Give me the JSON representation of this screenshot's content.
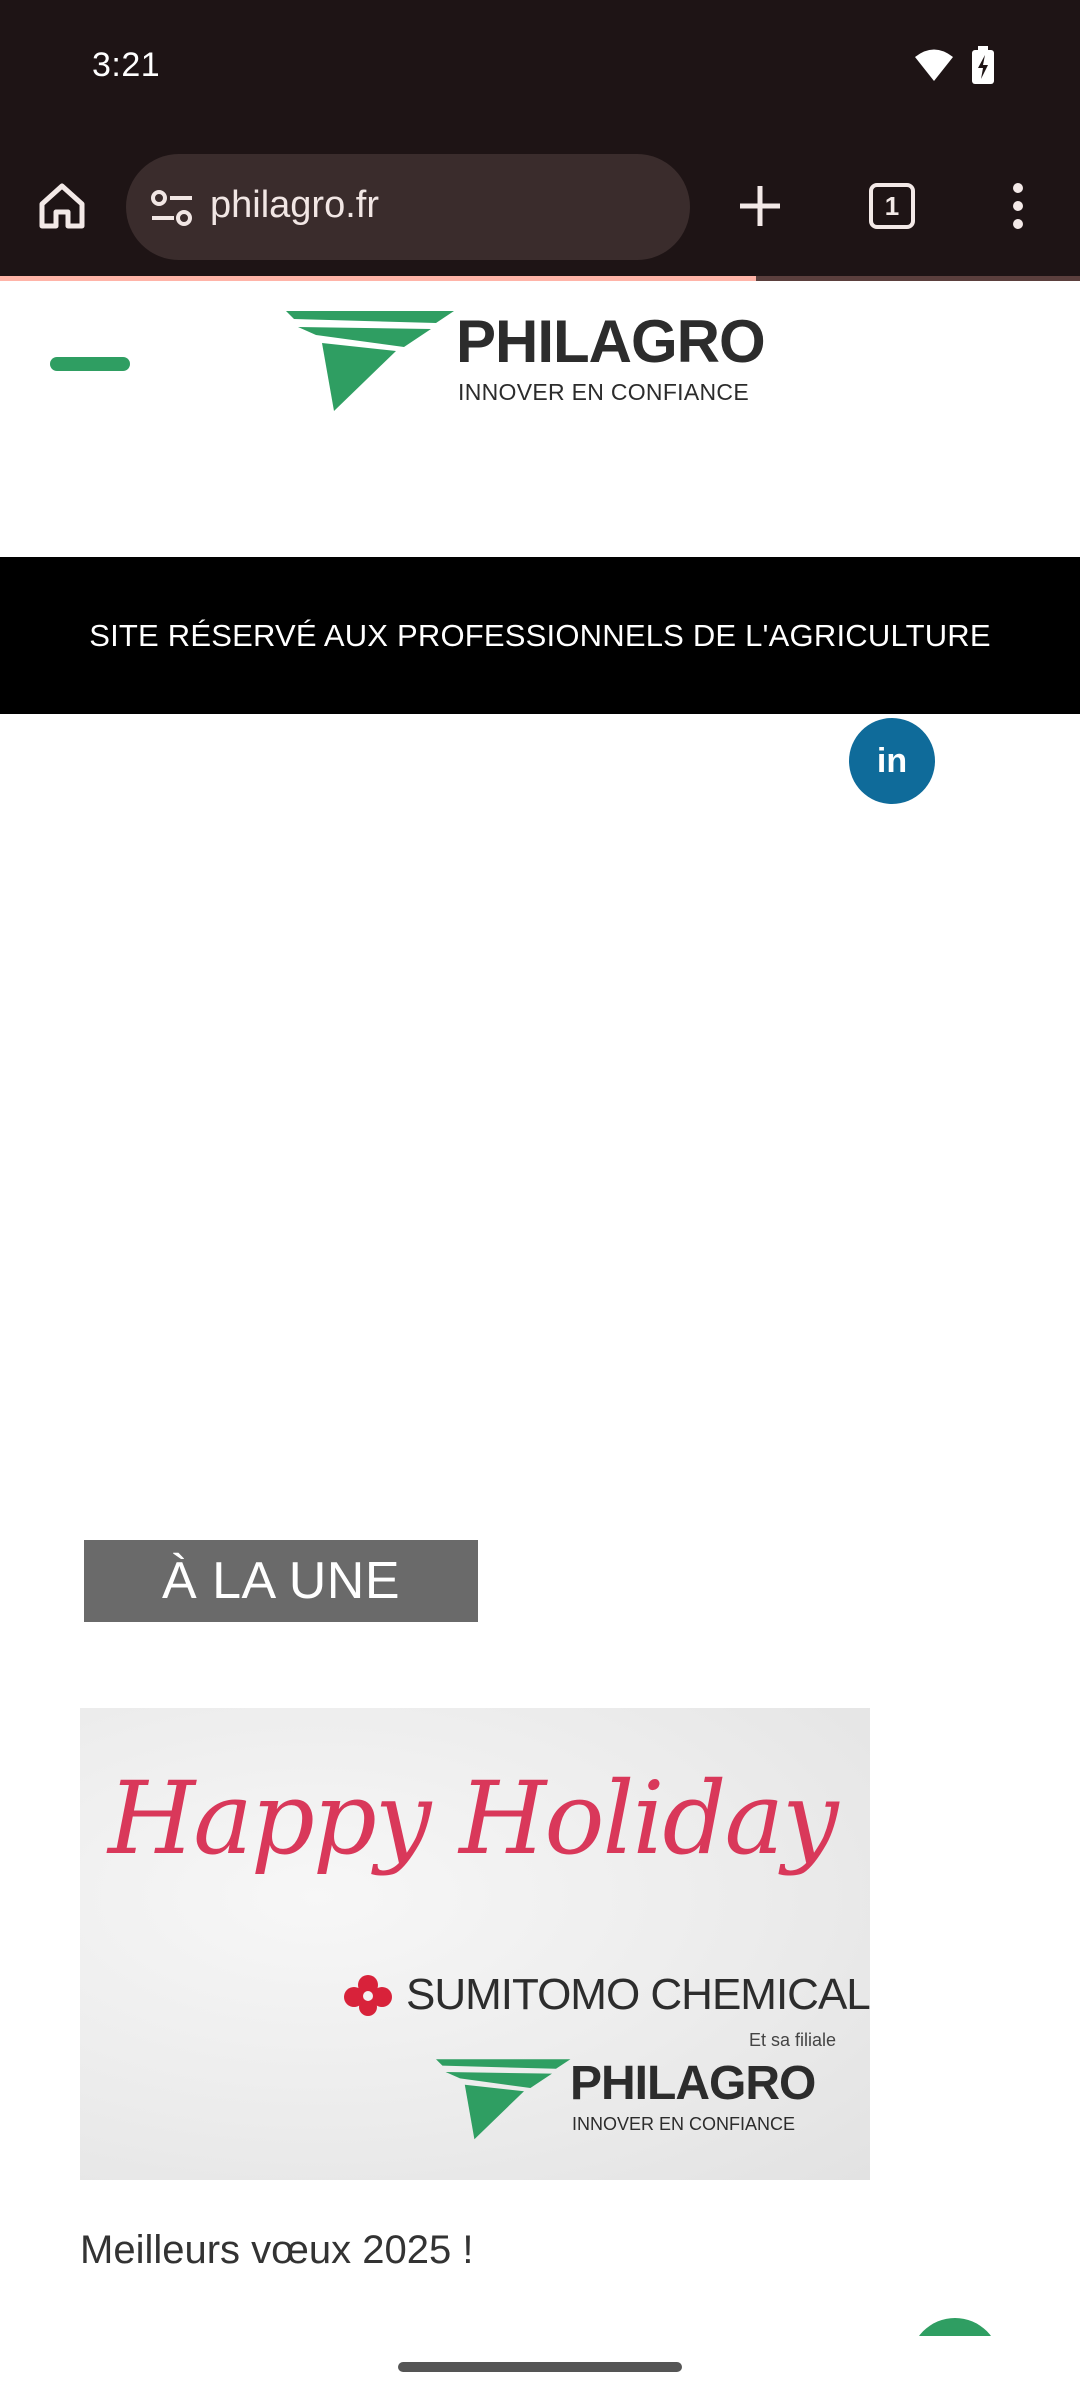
{
  "status_bar": {
    "time": "3:21",
    "icons": [
      "wifi-icon",
      "battery-charging-icon"
    ]
  },
  "browser": {
    "url": "philagro.fr",
    "tab_count": "1",
    "icons": [
      "home-icon",
      "site-settings-icon",
      "plus-icon",
      "tab-switcher-icon",
      "more-vert-icon"
    ],
    "page_load_progress_percent": 70,
    "colors": {
      "toolbar_bg": "#1e1415",
      "url_pill_bg": "#3a2c2c",
      "progress": "#ffb4a8"
    }
  },
  "site": {
    "logo_title": "PHILAGRO",
    "logo_tagline": "INNOVER EN CONFIANCE",
    "notice": "SITE RÉSERVÉ AUX PROFESSIONNELS DE L'AGRICULTURE",
    "linkedin_label": "in",
    "colors": {
      "brand_green": "#2f9e62",
      "linkedin_blue": "#0f6b9a"
    }
  },
  "featured": {
    "section_label": "À LA UNE",
    "card": {
      "image_text": {
        "greeting": "Happy Holiday",
        "company": "SUMITOMO CHEMICAL",
        "subsidiary_note": "Et sa filiale",
        "logo_title": "PHILAGRO",
        "logo_tagline": "INNOVER EN CONFIANCE"
      },
      "title": "Meilleurs vœux 2025 !"
    }
  }
}
